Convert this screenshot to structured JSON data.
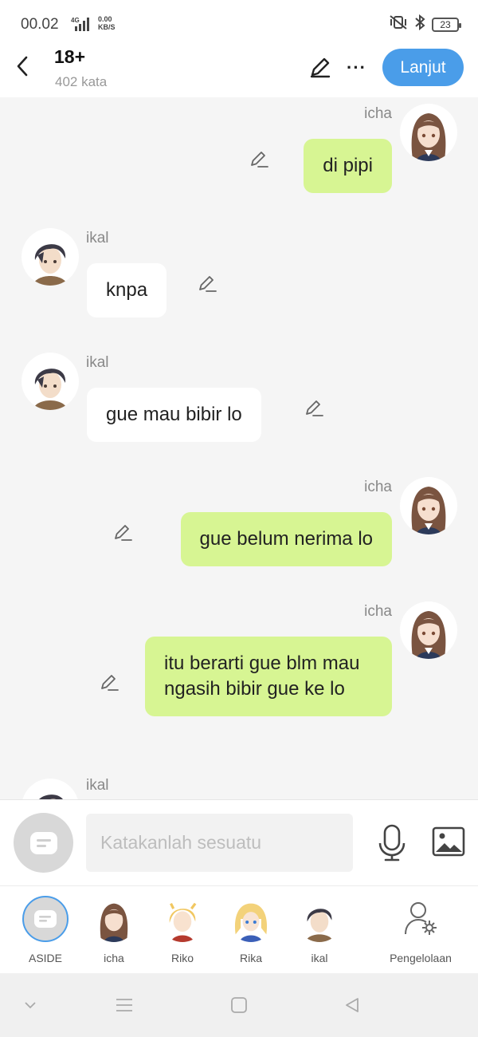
{
  "status": {
    "time": "00.02",
    "network": "4G",
    "speed_value": "0.00",
    "speed_unit": "KB/S",
    "battery": "23"
  },
  "header": {
    "title": "18+",
    "subtitle": "402 kata",
    "next_label": "Lanjut",
    "more_label": "···"
  },
  "messages": [
    {
      "sender": "icha",
      "text": "di pipi",
      "side": "right"
    },
    {
      "sender": "ikal",
      "text": "knpa",
      "side": "left"
    },
    {
      "sender": "ikal",
      "text": "gue mau bibir lo",
      "side": "left"
    },
    {
      "sender": "icha",
      "text": "gue belum nerima lo",
      "side": "right"
    },
    {
      "sender": "icha",
      "text": "itu berarti gue blm mau ngasih bibir gue ke lo",
      "side": "right"
    },
    {
      "sender": "ikal",
      "text": "",
      "side": "left"
    }
  ],
  "input": {
    "placeholder": "Katakanlah sesuatu"
  },
  "characters": [
    {
      "name": "ASIDE",
      "icon": "chat-bubble-icon"
    },
    {
      "name": "icha",
      "icon": "avatar-female-brown"
    },
    {
      "name": "Riko",
      "icon": "avatar-blonde-red"
    },
    {
      "name": "Rika",
      "icon": "avatar-blonde-blue"
    },
    {
      "name": "ikal",
      "icon": "avatar-male-dark"
    },
    {
      "name": "Pengelolaan",
      "icon": "user-settings-icon"
    }
  ],
  "colors": {
    "accent": "#4a9de9",
    "bubble_right": "#d7f593",
    "bubble_left": "#ffffff",
    "background": "#f5f5f5"
  }
}
